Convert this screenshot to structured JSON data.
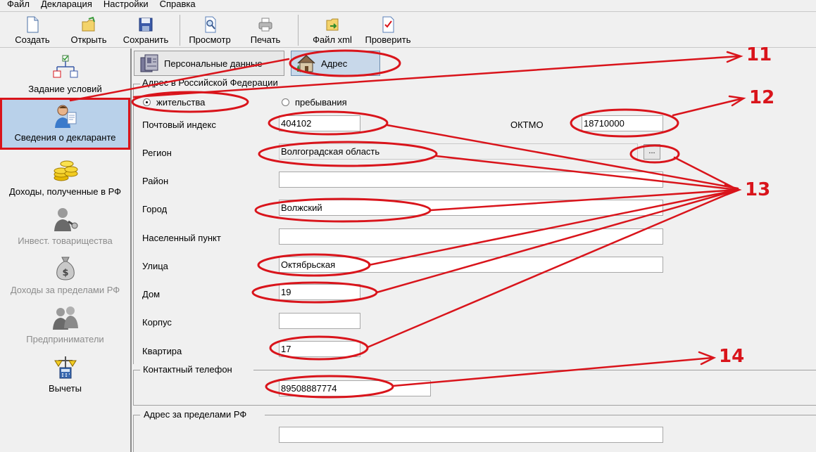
{
  "menu": [
    "Файл",
    "Декларация",
    "Настройки",
    "Справка"
  ],
  "toolbar": {
    "create": "Создать",
    "open": "Открыть",
    "save": "Сохранить",
    "preview": "Просмотр",
    "print": "Печать",
    "xml": "Файл xml",
    "check": "Проверить"
  },
  "sidebar": {
    "items": [
      {
        "label": "Задание условий",
        "icon": "conditions-icon"
      },
      {
        "label": "Сведения о декларанте",
        "icon": "declarant-icon"
      },
      {
        "label": "Доходы, полученные в РФ",
        "icon": "coins-icon"
      },
      {
        "label": "Инвест. товарищества",
        "icon": "investors-icon"
      },
      {
        "label": "Доходы за пределами РФ",
        "icon": "money-bag-icon"
      },
      {
        "label": "Предприниматели",
        "icon": "entrepreneurs-icon"
      },
      {
        "label": "Вычеты",
        "icon": "deductions-icon"
      }
    ]
  },
  "tabs": {
    "personal": "Персональные данные",
    "address": "Адрес"
  },
  "address": {
    "group_title": "Адрес в Российской Федерации",
    "radio_residence": "жительства",
    "radio_stay": "пребывания",
    "postal_label": "Почтовый индекс",
    "postal_value": "404102",
    "oktmo_label": "ОКТМО",
    "oktmo_value": "18710000",
    "region_label": "Регион",
    "region_value": "Волгоградская область",
    "region_button": "...",
    "district_label": "Район",
    "district_value": "",
    "city_label": "Город",
    "city_value": "Волжский",
    "locality_label": "Населенный пункт",
    "locality_value": "",
    "street_label": "Улица",
    "street_value": "Октябрьская",
    "house_label": "Дом",
    "house_value": "19",
    "building_label": "Корпус",
    "building_value": "",
    "apartment_label": "Квартира",
    "apartment_value": "17"
  },
  "contact": {
    "group_title": "Контактный телефон",
    "phone_value": "89508887774"
  },
  "abroad": {
    "group_title": "Адрес за пределами РФ",
    "value": ""
  },
  "callouts": [
    "11",
    "12",
    "13",
    "14"
  ],
  "colors": {
    "annotation": "#d9141b",
    "selected_bg": "#b9d1ea"
  }
}
